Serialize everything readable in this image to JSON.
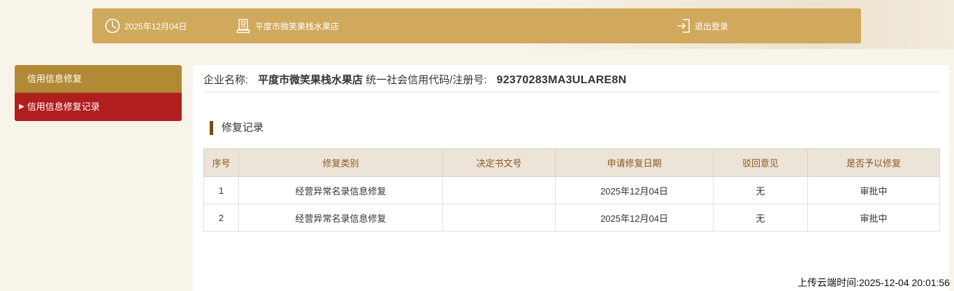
{
  "header": {
    "date": "2025年12月04日",
    "shop_name": "平度市微笑果栈水果店",
    "logout_label": "退出登录"
  },
  "sidebar": {
    "items": [
      {
        "label": "信用信息修复"
      },
      {
        "label": "信用信息修复记录"
      }
    ]
  },
  "company": {
    "name_label": "企业名称:",
    "name_value": "平度市微笑果栈水果店",
    "code_label": "统一社会信用代码/注册号:",
    "code_value": "92370283MA3ULARE8N"
  },
  "section_title": "修复记录",
  "table": {
    "headers": [
      "序号",
      "修复类别",
      "决定书文号",
      "申请修复日期",
      "驳回意见",
      "是否予以修复"
    ],
    "rows": [
      [
        "1",
        "经营异常名录信息修复",
        "",
        "2025年12月04日",
        "无",
        "审批中"
      ],
      [
        "2",
        "经营异常名录信息修复",
        "",
        "2025年12月04日",
        "无",
        "审批中"
      ]
    ]
  },
  "footer": {
    "upload_time": "上传云端时间:2025-12-04 20:01:56"
  },
  "colors": {
    "header_bar": "#d0a95c",
    "sidebar_active": "#b28a35",
    "sidebar_selected": "#b01e1e",
    "table_header_bg": "#ece3d9",
    "table_header_text": "#8b5a1c",
    "section_marker": "#7a4a0e"
  },
  "icons": {
    "date": "clock-icon",
    "shop": "building-icon",
    "logout": "logout-icon"
  }
}
